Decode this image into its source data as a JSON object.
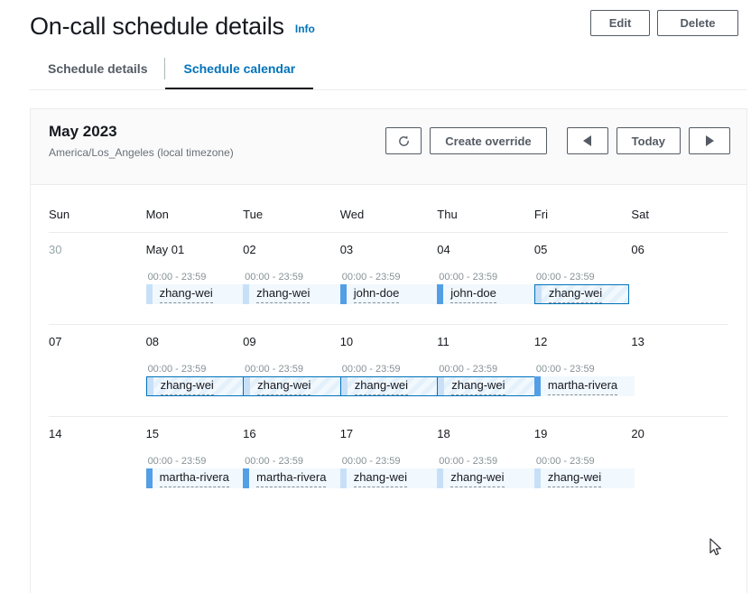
{
  "header": {
    "title": "On-call schedule details",
    "info_label": "Info",
    "edit_label": "Edit",
    "delete_label": "Delete"
  },
  "tabs": [
    {
      "label": "Schedule details",
      "active": false
    },
    {
      "label": "Schedule calendar",
      "active": true
    }
  ],
  "calendar": {
    "month_title": "May 2023",
    "timezone": "America/Los_Angeles (local timezone)",
    "refresh_icon": "refresh-icon",
    "create_override_label": "Create override",
    "prev_icon": "triangle-left-icon",
    "today_label": "Today",
    "next_icon": "triangle-right-icon",
    "day_headers": [
      "Sun",
      "Mon",
      "Tue",
      "Wed",
      "Thu",
      "Fri",
      "Sat"
    ],
    "weeks": [
      {
        "days": [
          {
            "date": "30",
            "muted": true,
            "time": "",
            "event": null
          },
          {
            "date": "May 01",
            "muted": false,
            "time": "00:00 - 23:59",
            "event": {
              "name": "zhang-wei",
              "accent": "light",
              "override": false
            }
          },
          {
            "date": "02",
            "muted": false,
            "time": "00:00 - 23:59",
            "event": {
              "name": "zhang-wei",
              "accent": "light",
              "override": false
            }
          },
          {
            "date": "03",
            "muted": false,
            "time": "00:00 - 23:59",
            "event": {
              "name": "john-doe",
              "accent": "mid",
              "override": false
            }
          },
          {
            "date": "04",
            "muted": false,
            "time": "00:00 - 23:59",
            "event": {
              "name": "john-doe",
              "accent": "mid",
              "override": false
            }
          },
          {
            "date": "05",
            "muted": false,
            "time": "00:00 - 23:59",
            "event": {
              "name": "zhang-wei",
              "accent": "light",
              "override": true
            }
          },
          {
            "date": "06",
            "muted": false,
            "time": "",
            "event": null
          }
        ]
      },
      {
        "days": [
          {
            "date": "07",
            "muted": false,
            "time": "",
            "event": null
          },
          {
            "date": "08",
            "muted": false,
            "time": "00:00 - 23:59",
            "event": {
              "name": "zhang-wei",
              "accent": "light",
              "override": true
            }
          },
          {
            "date": "09",
            "muted": false,
            "time": "00:00 - 23:59",
            "event": {
              "name": "zhang-wei",
              "accent": "light",
              "override": true
            }
          },
          {
            "date": "10",
            "muted": false,
            "time": "00:00 - 23:59",
            "event": {
              "name": "zhang-wei",
              "accent": "light",
              "override": true
            }
          },
          {
            "date": "11",
            "muted": false,
            "time": "00:00 - 23:59",
            "event": {
              "name": "zhang-wei",
              "accent": "light",
              "override": true
            }
          },
          {
            "date": "12",
            "muted": false,
            "time": "00:00 - 23:59",
            "event": {
              "name": "martha-rivera",
              "accent": "mid",
              "override": false
            }
          },
          {
            "date": "13",
            "muted": false,
            "time": "",
            "event": null
          }
        ]
      },
      {
        "days": [
          {
            "date": "14",
            "muted": false,
            "time": "",
            "event": null
          },
          {
            "date": "15",
            "muted": false,
            "time": "00:00 - 23:59",
            "event": {
              "name": "martha-rivera",
              "accent": "mid",
              "override": false
            }
          },
          {
            "date": "16",
            "muted": false,
            "time": "00:00 - 23:59",
            "event": {
              "name": "martha-rivera",
              "accent": "mid",
              "override": false
            }
          },
          {
            "date": "17",
            "muted": false,
            "time": "00:00 - 23:59",
            "event": {
              "name": "zhang-wei",
              "accent": "light",
              "override": false
            }
          },
          {
            "date": "18",
            "muted": false,
            "time": "00:00 - 23:59",
            "event": {
              "name": "zhang-wei",
              "accent": "light",
              "override": false
            }
          },
          {
            "date": "19",
            "muted": false,
            "time": "00:00 - 23:59",
            "event": {
              "name": "zhang-wei",
              "accent": "light",
              "override": false
            }
          },
          {
            "date": "20",
            "muted": false,
            "time": "",
            "event": null
          }
        ]
      }
    ]
  },
  "colors": {
    "link": "#0073bb",
    "text": "#16191f",
    "muted": "#687078",
    "accent_light": "#c8e0f7",
    "accent_mid": "#539fe5",
    "event_bg": "#f1f8fe"
  }
}
